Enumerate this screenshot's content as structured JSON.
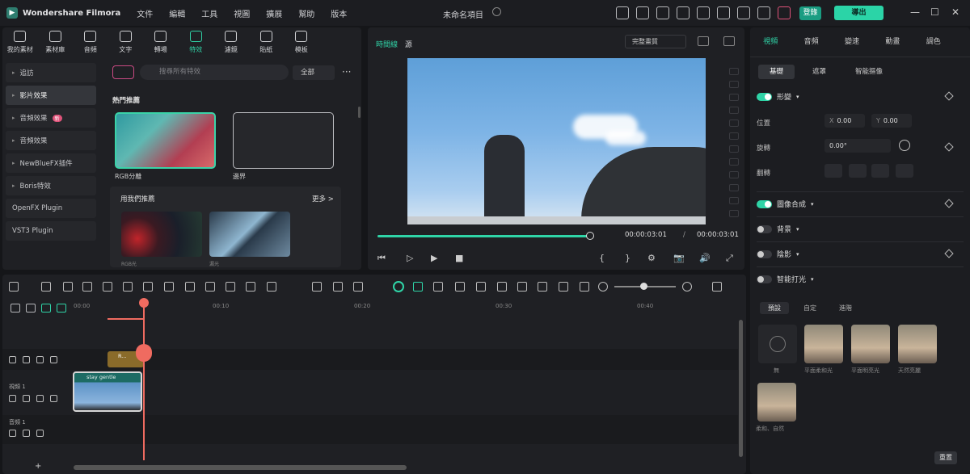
{
  "app": {
    "name": "Wondershare Filmora",
    "project_title": "未命名項目"
  },
  "menu": [
    "文件",
    "編輯",
    "工具",
    "視圖",
    "擴展",
    "幫助",
    "版本"
  ],
  "titlebar": {
    "login_label": "登錄",
    "export_label": "導出",
    "minimize": "—",
    "maximize": "☐",
    "close": "✕"
  },
  "asset_tabs": [
    {
      "label": "我的素材",
      "icon": "folder-icon"
    },
    {
      "label": "素材庫",
      "icon": "store-icon"
    },
    {
      "label": "音頻",
      "icon": "music-icon"
    },
    {
      "label": "文字",
      "icon": "text-icon"
    },
    {
      "label": "轉場",
      "icon": "transition-icon"
    },
    {
      "label": "特效",
      "icon": "effects-icon",
      "active": true
    },
    {
      "label": "濾鏡",
      "icon": "filter-icon"
    },
    {
      "label": "貼紙",
      "icon": "sticker-icon"
    },
    {
      "label": "模板",
      "icon": "template-icon"
    }
  ],
  "categories": [
    {
      "label": "追訪",
      "arrow": "▸"
    },
    {
      "label": "影片效果",
      "arrow": "▸",
      "selected": true
    },
    {
      "label": "音頻效果",
      "arrow": "▸",
      "badge": "新"
    },
    {
      "label": "音頻效果",
      "arrow": "▸"
    },
    {
      "label": "NewBlueFX插件",
      "arrow": "▸"
    },
    {
      "label": "Boris特效",
      "arrow": "▸"
    },
    {
      "label": "OpenFX Plugin",
      "arrow": ""
    },
    {
      "label": "VST3 Plugin",
      "arrow": ""
    }
  ],
  "search": {
    "placeholder": "搜尋所有特效",
    "filter_all": "全部",
    "more": "···"
  },
  "effects": {
    "hot_label": "熱門推薦",
    "cards": [
      {
        "label": "RGB分離"
      },
      {
        "label": "邊界"
      }
    ],
    "recommend_label": "用我們推薦",
    "recommend_more": "更多 >",
    "rec_cards": [
      {
        "label": "RGB光"
      },
      {
        "label": "漏光"
      }
    ]
  },
  "preview": {
    "tab_timeline": "時間線",
    "tab_source": "源",
    "quality": "完整畫質",
    "time_current": "00:00:03:01",
    "time_sep": "/",
    "time_total": "00:00:03:01",
    "progress": 0.98,
    "controls": [
      "⏮",
      "▷",
      "▶",
      "■",
      "{",
      "}",
      "⚙",
      "📷",
      "🔊",
      "⤢"
    ]
  },
  "properties": {
    "tabs": [
      {
        "label": "視頻",
        "active": true
      },
      {
        "label": "音頻"
      },
      {
        "label": "變速"
      },
      {
        "label": "動畫"
      },
      {
        "label": "調色"
      }
    ],
    "subtabs": [
      {
        "label": "基礎",
        "active": true
      },
      {
        "label": "遮罩"
      },
      {
        "label": "智能摳像"
      }
    ],
    "transform": {
      "label": "形變",
      "position_label": "位置",
      "x": "0.00",
      "y": "0.00",
      "rotate_label": "旋轉",
      "rotate": "0.00°",
      "flip_label": "翻轉",
      "x_prefix": "X",
      "y_prefix": "Y"
    },
    "sections": [
      {
        "label": "圖像合成",
        "on": true
      },
      {
        "label": "背景",
        "on": false
      },
      {
        "label": "陰影",
        "on": false
      },
      {
        "label": "智能打光",
        "on": false
      }
    ],
    "light_pills": [
      {
        "label": "預設",
        "active": true
      },
      {
        "label": "自定"
      },
      {
        "label": "進階"
      }
    ],
    "light_presets": [
      {
        "label": "無"
      },
      {
        "label": "平面柔和光"
      },
      {
        "label": "平面明亮光"
      },
      {
        "label": "天然亮麗"
      },
      {
        "label": "柔和、自然"
      }
    ],
    "reset_label": "重置"
  },
  "timeline": {
    "ruler": [
      "00:00",
      "00:10",
      "00:20",
      "00:30",
      "00:40"
    ],
    "tracks": [
      {
        "label": ""
      },
      {
        "label": "視頻 1"
      },
      {
        "label": "音頻 1"
      }
    ],
    "clip_video_label": "stay gentle",
    "clip_fx_label": "R...",
    "add_track": "+"
  },
  "colors": {
    "accent": "#2fd4a7",
    "playhead": "#ef6b60",
    "panel": "#1f2024"
  }
}
